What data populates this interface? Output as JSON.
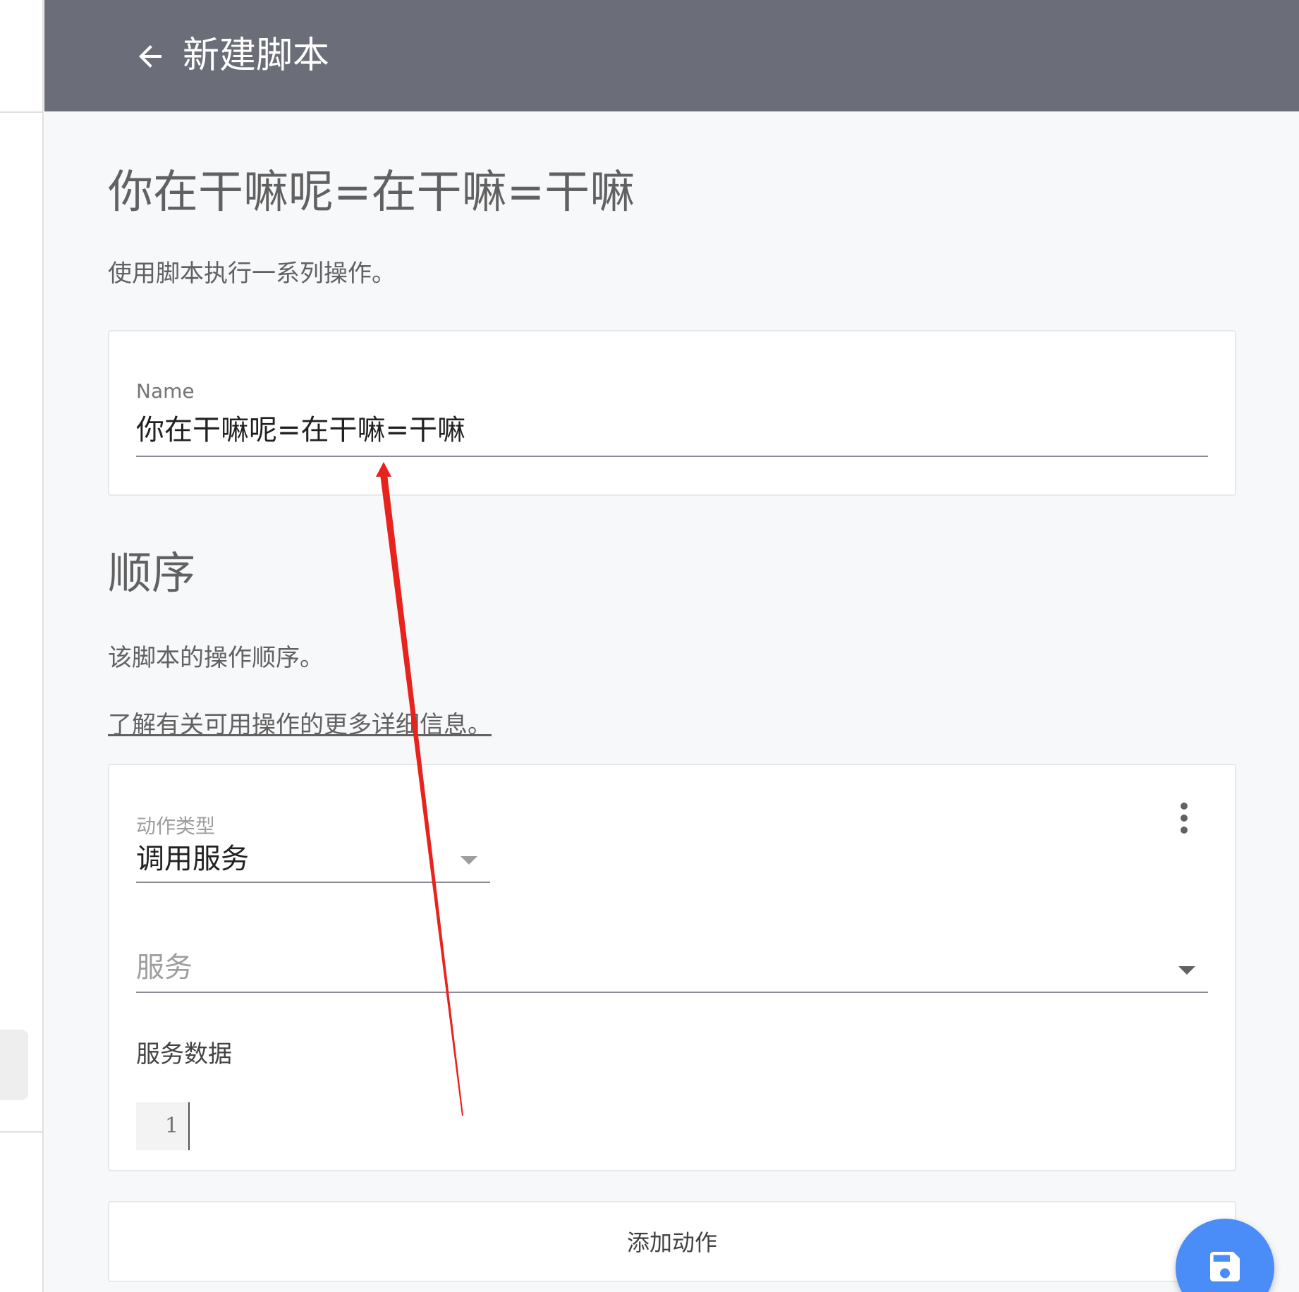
{
  "appbar": {
    "title": "新建脚本",
    "back_icon": "arrow-left-icon",
    "background": "#6b6e78"
  },
  "header": {
    "title": "你在干嘛呢=在干嘛=干嘛",
    "description": "使用脚本执行一系列操作。"
  },
  "name_field": {
    "label": "Name",
    "value": "你在干嘛呢=在干嘛=干嘛"
  },
  "sequence": {
    "title": "顺序",
    "description": "该脚本的操作顺序。",
    "learn_more_link": "了解有关可用操作的更多详细信息。"
  },
  "action": {
    "type_label": "动作类型",
    "type_value": "调用服务",
    "service_placeholder": "服务",
    "service_data_label": "服务数据",
    "editor_line_numbers": [
      "1"
    ],
    "more_icon": "more-vert-icon"
  },
  "add_action_label": "添加动作",
  "fab": {
    "icon": "save-icon",
    "color": "#4a8df8"
  },
  "annotation": {
    "color": "#e8231e"
  }
}
